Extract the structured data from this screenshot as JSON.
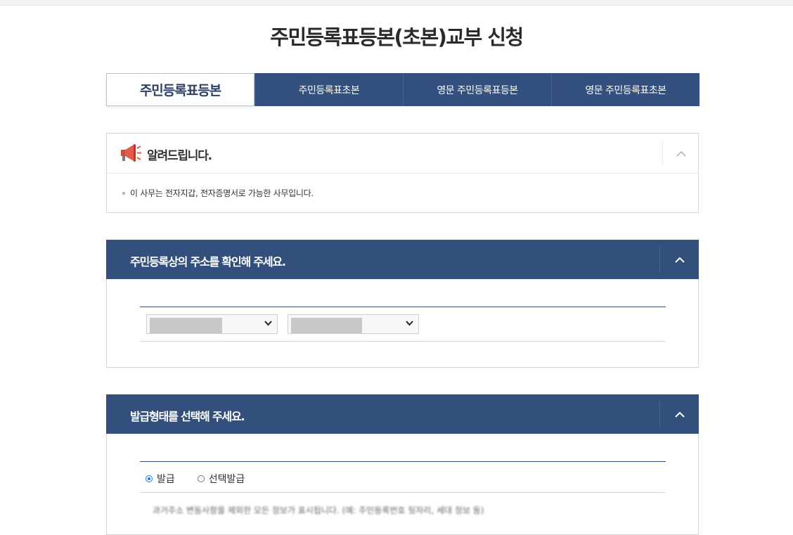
{
  "page": {
    "title": "주민등록표등본(초본)교부 신청"
  },
  "tabs": [
    {
      "label": "주민등록표등본",
      "active": true
    },
    {
      "label": "주민등록표초본",
      "active": false
    },
    {
      "label": "영문 주민등록표등본",
      "active": false
    },
    {
      "label": "영문 주민등록표초본",
      "active": false
    }
  ],
  "notice": {
    "title": "알려드립니다.",
    "icon": "megaphone-icon",
    "message": "이 사무는 전자지갑, 전자증명서로 가능한 사무입니다."
  },
  "address_section": {
    "title": "주민등록상의 주소를 확인해 주세요.",
    "selects": [
      {
        "name": "address-select-1",
        "value": ""
      },
      {
        "name": "address-select-2",
        "value": ""
      }
    ]
  },
  "issue_section": {
    "title": "발급형태를 선택해 주세요.",
    "options": [
      {
        "label": "발급",
        "checked": true
      },
      {
        "label": "선택발급",
        "checked": false
      }
    ],
    "note": "과거주소 변동사항을 제외한 모든 정보가 표시됩니다. (예: 주민등록번호 뒷자리, 세대 정보 등)"
  },
  "colors": {
    "primary": "#334f7c",
    "accent": "#1a73e8"
  }
}
